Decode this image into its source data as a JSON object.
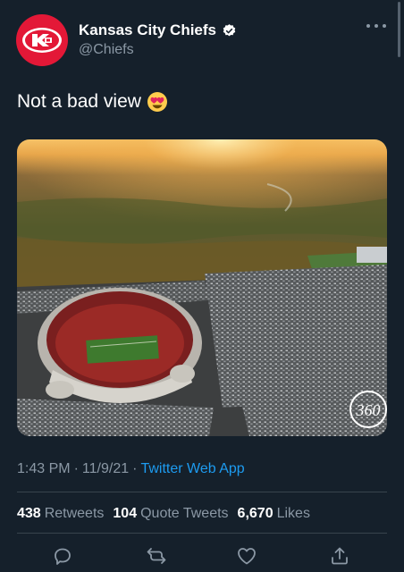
{
  "tweet": {
    "display_name": "Kansas City Chiefs",
    "handle": "@Chiefs",
    "verified_icon": "verified-badge-icon",
    "text": "Not a bad view",
    "emoji": "heart-eyes-emoji",
    "media": {
      "watermark": "360"
    },
    "time": "1:43 PM",
    "separator1": "·",
    "date": "11/9/21",
    "separator2": "·",
    "source": "Twitter Web App"
  },
  "stats": {
    "retweets_count": "438",
    "retweets_label": "Retweets",
    "quotes_count": "104",
    "quotes_label": "Quote Tweets",
    "likes_count": "6,670",
    "likes_label": "Likes"
  },
  "colors": {
    "background": "#15202b",
    "brand_red": "#e31837",
    "secondary_text": "#8b98a5",
    "link": "#1d9bf0",
    "divider": "#38444d"
  },
  "icons": [
    "more-icon",
    "reply-icon",
    "retweet-icon",
    "like-icon",
    "share-icon"
  ]
}
